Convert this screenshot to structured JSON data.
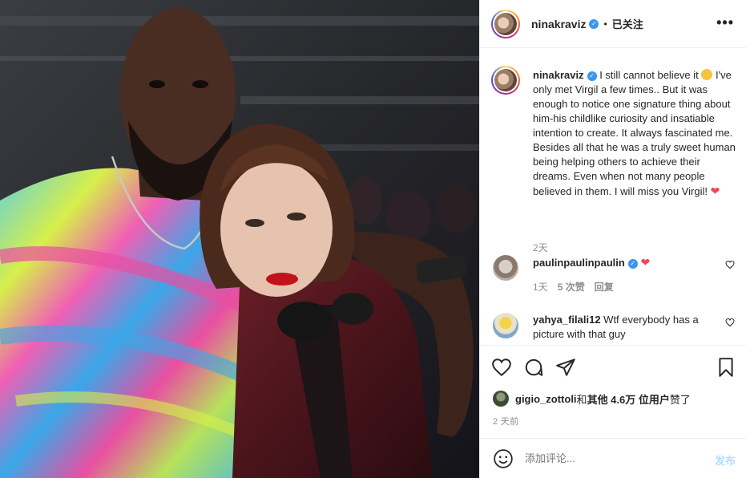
{
  "header": {
    "username": "ninakraviz",
    "dot": "•",
    "follow_label": "已关注",
    "more_label": "•••"
  },
  "caption": {
    "username": "ninakraviz",
    "text_1": " I still cannot believe it ",
    "text_2": " I've only met Virgil a few times.. But it was enough to notice one signature thing about him-his childlike curiosity and insatiable intention to create. It always fascinated me. Besides all that he was a truly sweet human being helping others to achieve their dreams. Even when not many people believed in them. I will miss you Virgil! ",
    "heart": "❤",
    "time": "2天"
  },
  "comments": [
    {
      "username": "paulinpaulinpaulin",
      "text": " ",
      "heart": "❤",
      "time": "1天",
      "likes": "5 次赞",
      "reply": "回复"
    },
    {
      "username": "yahya_filali12",
      "text": " Wtf everybody has a picture with that guy"
    }
  ],
  "likes": {
    "user": "gigio_zottoli",
    "and": " 和 ",
    "others": "其他 4.6万 位用户",
    "liked": " 赞了"
  },
  "timestamp": "2 天前",
  "comment_box": {
    "placeholder": "添加评论...",
    "publish_label": "发布"
  },
  "icons": {
    "more": "more-dots-icon",
    "like": "heart-icon",
    "comment": "comment-bubble-icon",
    "share": "paper-plane-icon",
    "save": "bookmark-icon",
    "emoji": "smiley-icon",
    "verified": "verified-badge-icon"
  },
  "colors": {
    "verified": "#3897f0",
    "heart": "#ed4956",
    "publish_disabled": "#b2dffc",
    "secondary_text": "#8e8e8e"
  }
}
